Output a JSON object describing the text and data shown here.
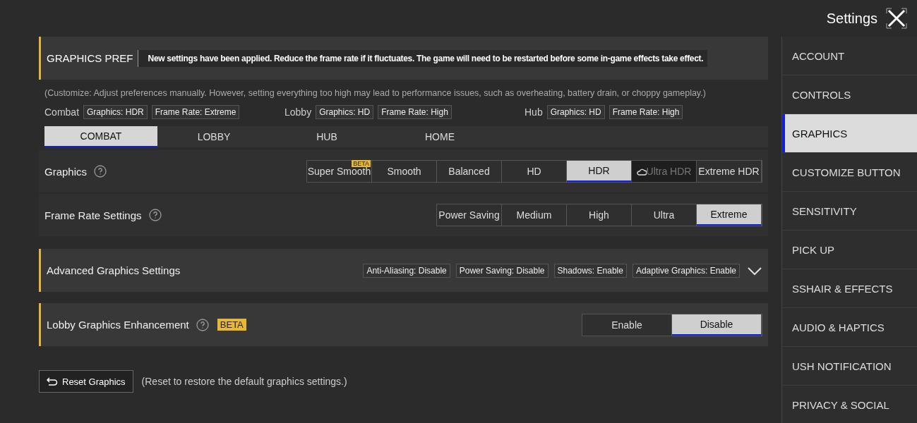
{
  "header": {
    "title": "Settings"
  },
  "preference": {
    "title": "GRAPHICS PREF",
    "toast": "New settings have been applied. Reduce the frame rate if it fluctuates. The game will need to be restarted before some in-game effects take effect."
  },
  "description": "(Customize: Adjust preferences manually. However, setting everything too high may lead to performance issues, such as overheating, battery drain, or choppy gameplay.)",
  "summaries": [
    {
      "label": "Combat",
      "tags": [
        "Graphics: HDR",
        "Frame Rate: Extreme"
      ]
    },
    {
      "label": "Lobby",
      "tags": [
        "Graphics: HD",
        "Frame Rate: High"
      ]
    },
    {
      "label": "Hub",
      "tags": [
        "Graphics: HD",
        "Frame Rate: High"
      ]
    }
  ],
  "mode_tabs": [
    {
      "label": "COMBAT",
      "selected": true
    },
    {
      "label": "LOBBY",
      "selected": false
    },
    {
      "label": "HUB",
      "selected": false
    },
    {
      "label": "HOME",
      "selected": false
    }
  ],
  "graphics": {
    "label": "Graphics",
    "options": [
      {
        "label": "Super Smooth",
        "badge": "BETA",
        "selected": false,
        "disabled": false
      },
      {
        "label": "Smooth",
        "selected": false,
        "disabled": false
      },
      {
        "label": "Balanced",
        "selected": false,
        "disabled": false
      },
      {
        "label": "HD",
        "selected": false,
        "disabled": false
      },
      {
        "label": "HDR",
        "selected": true,
        "disabled": false
      },
      {
        "label": "Ultra HDR",
        "selected": false,
        "disabled": true
      },
      {
        "label": "Extreme HDR",
        "selected": false,
        "disabled": false
      }
    ]
  },
  "frame_rate": {
    "label": "Frame Rate Settings",
    "options": [
      {
        "label": "Power Saving",
        "selected": false,
        "disabled": false
      },
      {
        "label": "Medium",
        "selected": false,
        "disabled": false
      },
      {
        "label": "High",
        "selected": false,
        "disabled": false
      },
      {
        "label": "Ultra",
        "selected": false,
        "disabled": false
      },
      {
        "label": "Extreme",
        "selected": true,
        "disabled": false
      }
    ]
  },
  "advanced": {
    "title": "Advanced Graphics Settings",
    "expanded": false,
    "tags": [
      "Anti-Aliasing: Disable",
      "Power Saving: Disable",
      "Shadows: Enable",
      "Adaptive Graphics: Enable"
    ]
  },
  "lobby_enhancement": {
    "title": "Lobby Graphics Enhancement",
    "badge": "BETA",
    "options": [
      {
        "label": "Enable",
        "selected": false,
        "disabled": false
      },
      {
        "label": "Disable",
        "selected": true,
        "disabled": false
      }
    ]
  },
  "reset": {
    "button": "Reset Graphics",
    "note": "(Reset to restore the default graphics settings.)"
  },
  "sidebar": {
    "items": [
      {
        "label": "ACCOUNT",
        "selected": false
      },
      {
        "label": "CONTROLS",
        "selected": false
      },
      {
        "label": "GRAPHICS",
        "selected": true
      },
      {
        "label": "CUSTOMIZE BUTTON",
        "selected": false
      },
      {
        "label": "SENSITIVITY",
        "selected": false
      },
      {
        "label": "PICK UP",
        "selected": false
      },
      {
        "label": "SSHAIR & EFFECTS",
        "selected": false
      },
      {
        "label": "AUDIO & HAPTICS",
        "selected": false
      },
      {
        "label": "USH NOTIFICATION",
        "selected": false
      },
      {
        "label": "PRIVACY & SOCIAL",
        "selected": false
      }
    ]
  }
}
